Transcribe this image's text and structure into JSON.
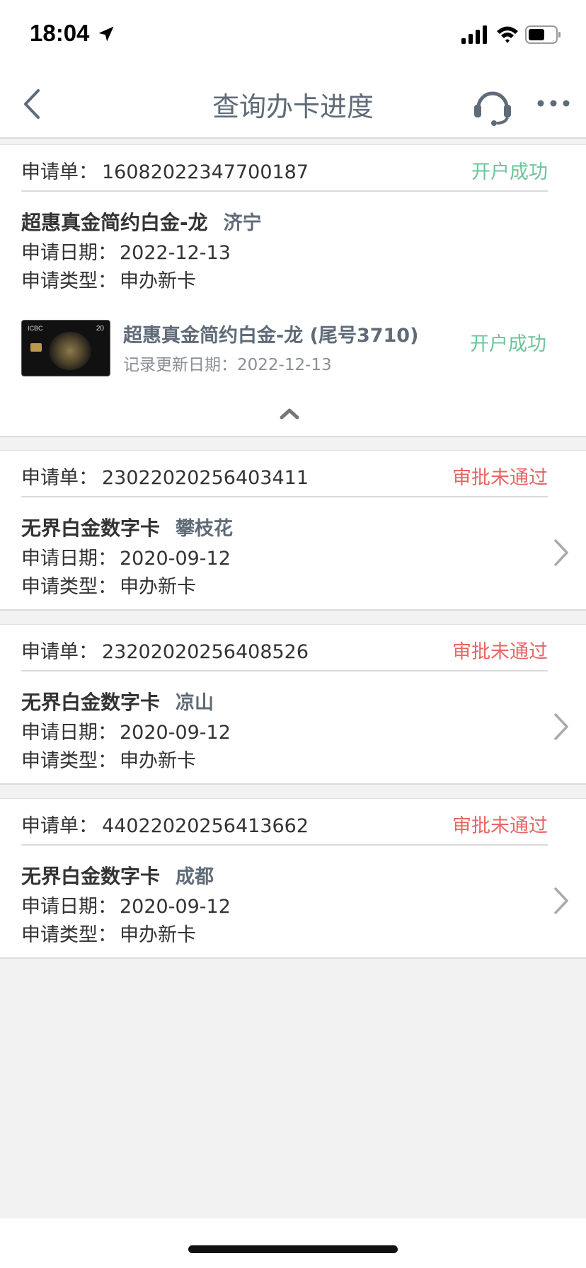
{
  "status_bar": {
    "time": "18:04"
  },
  "nav": {
    "title": "查询办卡进度"
  },
  "expanded_application": {
    "label": "申请单",
    "colon": "：",
    "number": "16082022347700187",
    "status": "开户成功",
    "card_name": "超惠真金简约白金-龙",
    "city": "济宁",
    "date_label": "申请日期：",
    "date": "2022-12-13",
    "type_label": "申请类型：",
    "type": "申办新卡",
    "detail": {
      "card_title": "超惠真金简约白金-龙 (尾号3710)",
      "update_label": "记录更新日期：",
      "update_date": "2022-12-13",
      "status": "开户成功",
      "thumb_brand": "ICBC",
      "thumb_num": "20"
    }
  },
  "applications": [
    {
      "label": "申请单",
      "colon": "：",
      "number": "23022020256403411",
      "status": "审批未通过",
      "card_name": "无界白金数字卡",
      "city": "攀枝花",
      "date_label": "申请日期：",
      "date": "2020-09-12",
      "type_label": "申请类型：",
      "type": "申办新卡"
    },
    {
      "label": "申请单",
      "colon": "：",
      "number": "23202020256408526",
      "status": "审批未通过",
      "card_name": "无界白金数字卡",
      "city": "凉山",
      "date_label": "申请日期：",
      "date": "2020-09-12",
      "type_label": "申请类型：",
      "type": "申办新卡"
    },
    {
      "label": "申请单",
      "colon": "：",
      "number": "44022020256413662",
      "status": "审批未通过",
      "card_name": "无界白金数字卡",
      "city": "成都",
      "date_label": "申请日期：",
      "date": "2020-09-12",
      "type_label": "申请类型：",
      "type": "申办新卡"
    }
  ],
  "colors": {
    "success": "#6cc59a",
    "fail": "#e96565",
    "title": "#5f6b78"
  },
  "icons": [
    "location-arrow-icon",
    "signal-icon",
    "wifi-icon",
    "battery-icon",
    "back-icon",
    "headset-icon",
    "more-icon",
    "chevron-up-icon",
    "chevron-right-icon"
  ]
}
